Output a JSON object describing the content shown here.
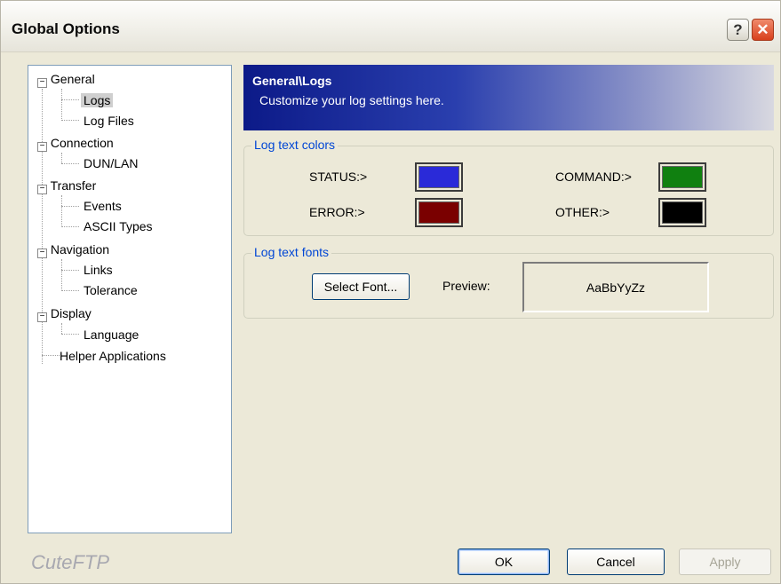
{
  "window": {
    "title": "Global Options",
    "help_label": "?",
    "close_label": "✕"
  },
  "tree": {
    "items": [
      {
        "label": "General",
        "expander": "−"
      },
      {
        "label": "Logs"
      },
      {
        "label": "Log Files"
      },
      {
        "label": "Connection",
        "expander": "−"
      },
      {
        "label": "DUN/LAN"
      },
      {
        "label": "Transfer",
        "expander": "−"
      },
      {
        "label": "Events"
      },
      {
        "label": "ASCII Types"
      },
      {
        "label": "Navigation",
        "expander": "−"
      },
      {
        "label": "Links"
      },
      {
        "label": "Tolerance"
      },
      {
        "label": "Display",
        "expander": "−"
      },
      {
        "label": "Language"
      },
      {
        "label": "Helper Applications"
      }
    ],
    "selected": "Logs"
  },
  "header": {
    "title": "General\\Logs",
    "subtitle": "Customize your log settings here."
  },
  "colors_group": {
    "legend": "Log text colors",
    "status_label": "STATUS:>",
    "error_label": "ERROR:>",
    "command_label": "COMMAND:>",
    "other_label": "OTHER:>",
    "status_color": "#2a2ad8",
    "error_color": "#7a0000",
    "command_color": "#108010",
    "other_color": "#000000"
  },
  "fonts_group": {
    "legend": "Log text fonts",
    "select_font_label": "Select Font...",
    "preview_label": "Preview:",
    "preview_text": "AaBbYyZz"
  },
  "footer": {
    "brand": "CuteFTP",
    "ok_label": "OK",
    "cancel_label": "Cancel",
    "apply_label": "Apply"
  }
}
